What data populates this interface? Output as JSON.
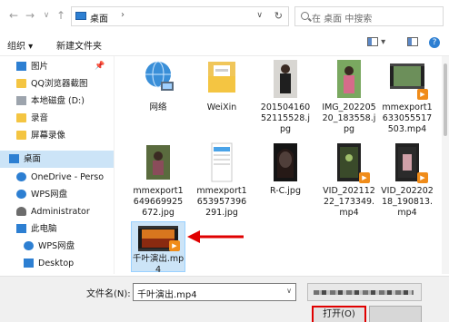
{
  "address": {
    "breadcrumb": "桌面",
    "search_placeholder": "在 桌面 中搜索"
  },
  "toolbar": {
    "organize": "组织 ▾",
    "new_folder": "新建文件夹"
  },
  "sidebar": {
    "items": [
      {
        "label": "图片",
        "icon": "folder-icon"
      },
      {
        "label": "QQ浏览器截图",
        "icon": "folder-icon"
      },
      {
        "label": "本地磁盘 (D:)",
        "icon": "drive-icon"
      },
      {
        "label": "录音",
        "icon": "folder-icon"
      },
      {
        "label": "屏幕录像",
        "icon": "folder-icon"
      },
      {
        "label": "桌面",
        "icon": "desktop-icon"
      },
      {
        "label": "OneDrive - Perso",
        "icon": "cloud-icon"
      },
      {
        "label": "WPS网盘",
        "icon": "cloud-icon"
      },
      {
        "label": "Administrator",
        "icon": "user-icon"
      },
      {
        "label": "此电脑",
        "icon": "computer-icon"
      },
      {
        "label": "WPS网盘",
        "icon": "cloud-icon"
      },
      {
        "label": "Desktop",
        "icon": "desktop-icon"
      }
    ]
  },
  "files": [
    {
      "name": "网络",
      "type": "network"
    },
    {
      "name": "WeiXin",
      "type": "folder"
    },
    {
      "name": "20150416052115528.jpg",
      "type": "photo"
    },
    {
      "name": "IMG_20220520_183558.jpg",
      "type": "photo"
    },
    {
      "name": "mmexport1633055517503.mp4",
      "type": "video"
    },
    {
      "name": "mmexport1649669925672.jpg",
      "type": "photo"
    },
    {
      "name": "mmexport1653957396291.jpg",
      "type": "phone"
    },
    {
      "name": "R-C.jpg",
      "type": "photo"
    },
    {
      "name": "VID_20211222_173349.mp4",
      "type": "video"
    },
    {
      "name": "VID_20220218_190813.mp4",
      "type": "video"
    },
    {
      "name": "千叶演出.mp4",
      "type": "video"
    }
  ],
  "bottom": {
    "filename_label": "文件名(N):",
    "filename_value": "千叶演出.mp4",
    "open_label": "打开(O)"
  },
  "colors": {
    "selection": "#cce4f7",
    "annotation_red": "#e00000",
    "accent_blue": "#2d7fd2"
  }
}
